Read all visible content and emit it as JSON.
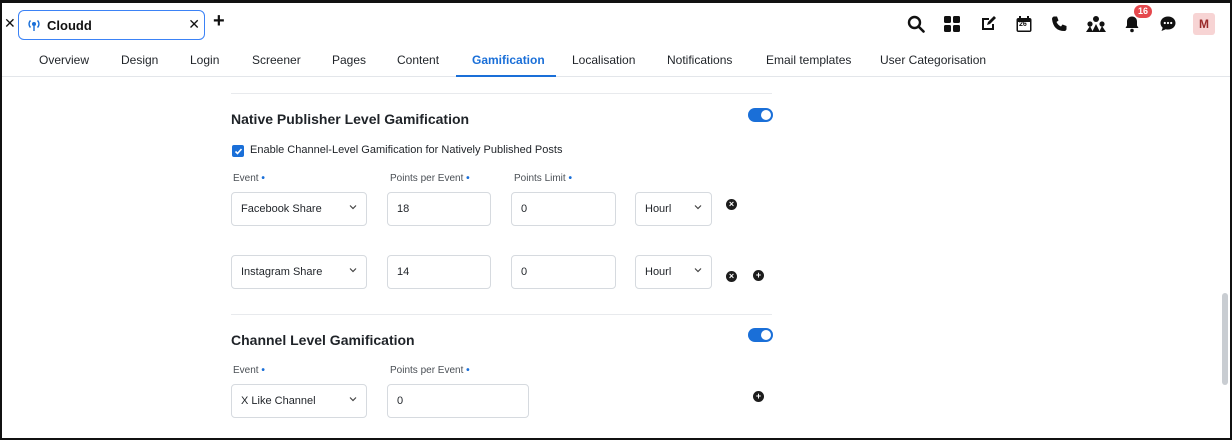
{
  "tab": {
    "title": "Cloudd",
    "icon": "broadcast-icon"
  },
  "toolbar": {
    "icons": [
      "search-icon",
      "grid-icon",
      "edit-icon",
      "calendar-icon",
      "phone-icon",
      "community-icon",
      "bell-icon",
      "chat-icon"
    ],
    "calendar_day": "26",
    "notification_count": "16",
    "avatar_initial": "M"
  },
  "nav": {
    "items": [
      "Overview",
      "Design",
      "Login",
      "Screener",
      "Pages",
      "Content",
      "Gamification",
      "Localisation",
      "Notifications",
      "Email templates",
      "User Categorisation"
    ],
    "active": "Gamification"
  },
  "native_section": {
    "title": "Native Publisher Level Gamification",
    "toggle_on": true,
    "checkbox_label": "Enable Channel-Level Gamification for Natively Published Posts",
    "checkbox_checked": true,
    "labels": {
      "event": "Event",
      "points": "Points per Event",
      "limit": "Points Limit",
      "required_mark": "•"
    },
    "rows": [
      {
        "event": "Facebook Share",
        "points": "18",
        "limit": "0",
        "period": "Hourl"
      },
      {
        "event": "Instagram Share",
        "points": "14",
        "limit": "0",
        "period": "Hourl"
      }
    ]
  },
  "channel_section": {
    "title": "Channel Level Gamification",
    "toggle_on": true,
    "labels": {
      "event": "Event",
      "points": "Points per Event",
      "required_mark": "•"
    },
    "rows": [
      {
        "event": "X Like Channel",
        "points": "0"
      }
    ]
  },
  "colors": {
    "accent": "#1a6fd8",
    "badge": "#e5484d"
  }
}
